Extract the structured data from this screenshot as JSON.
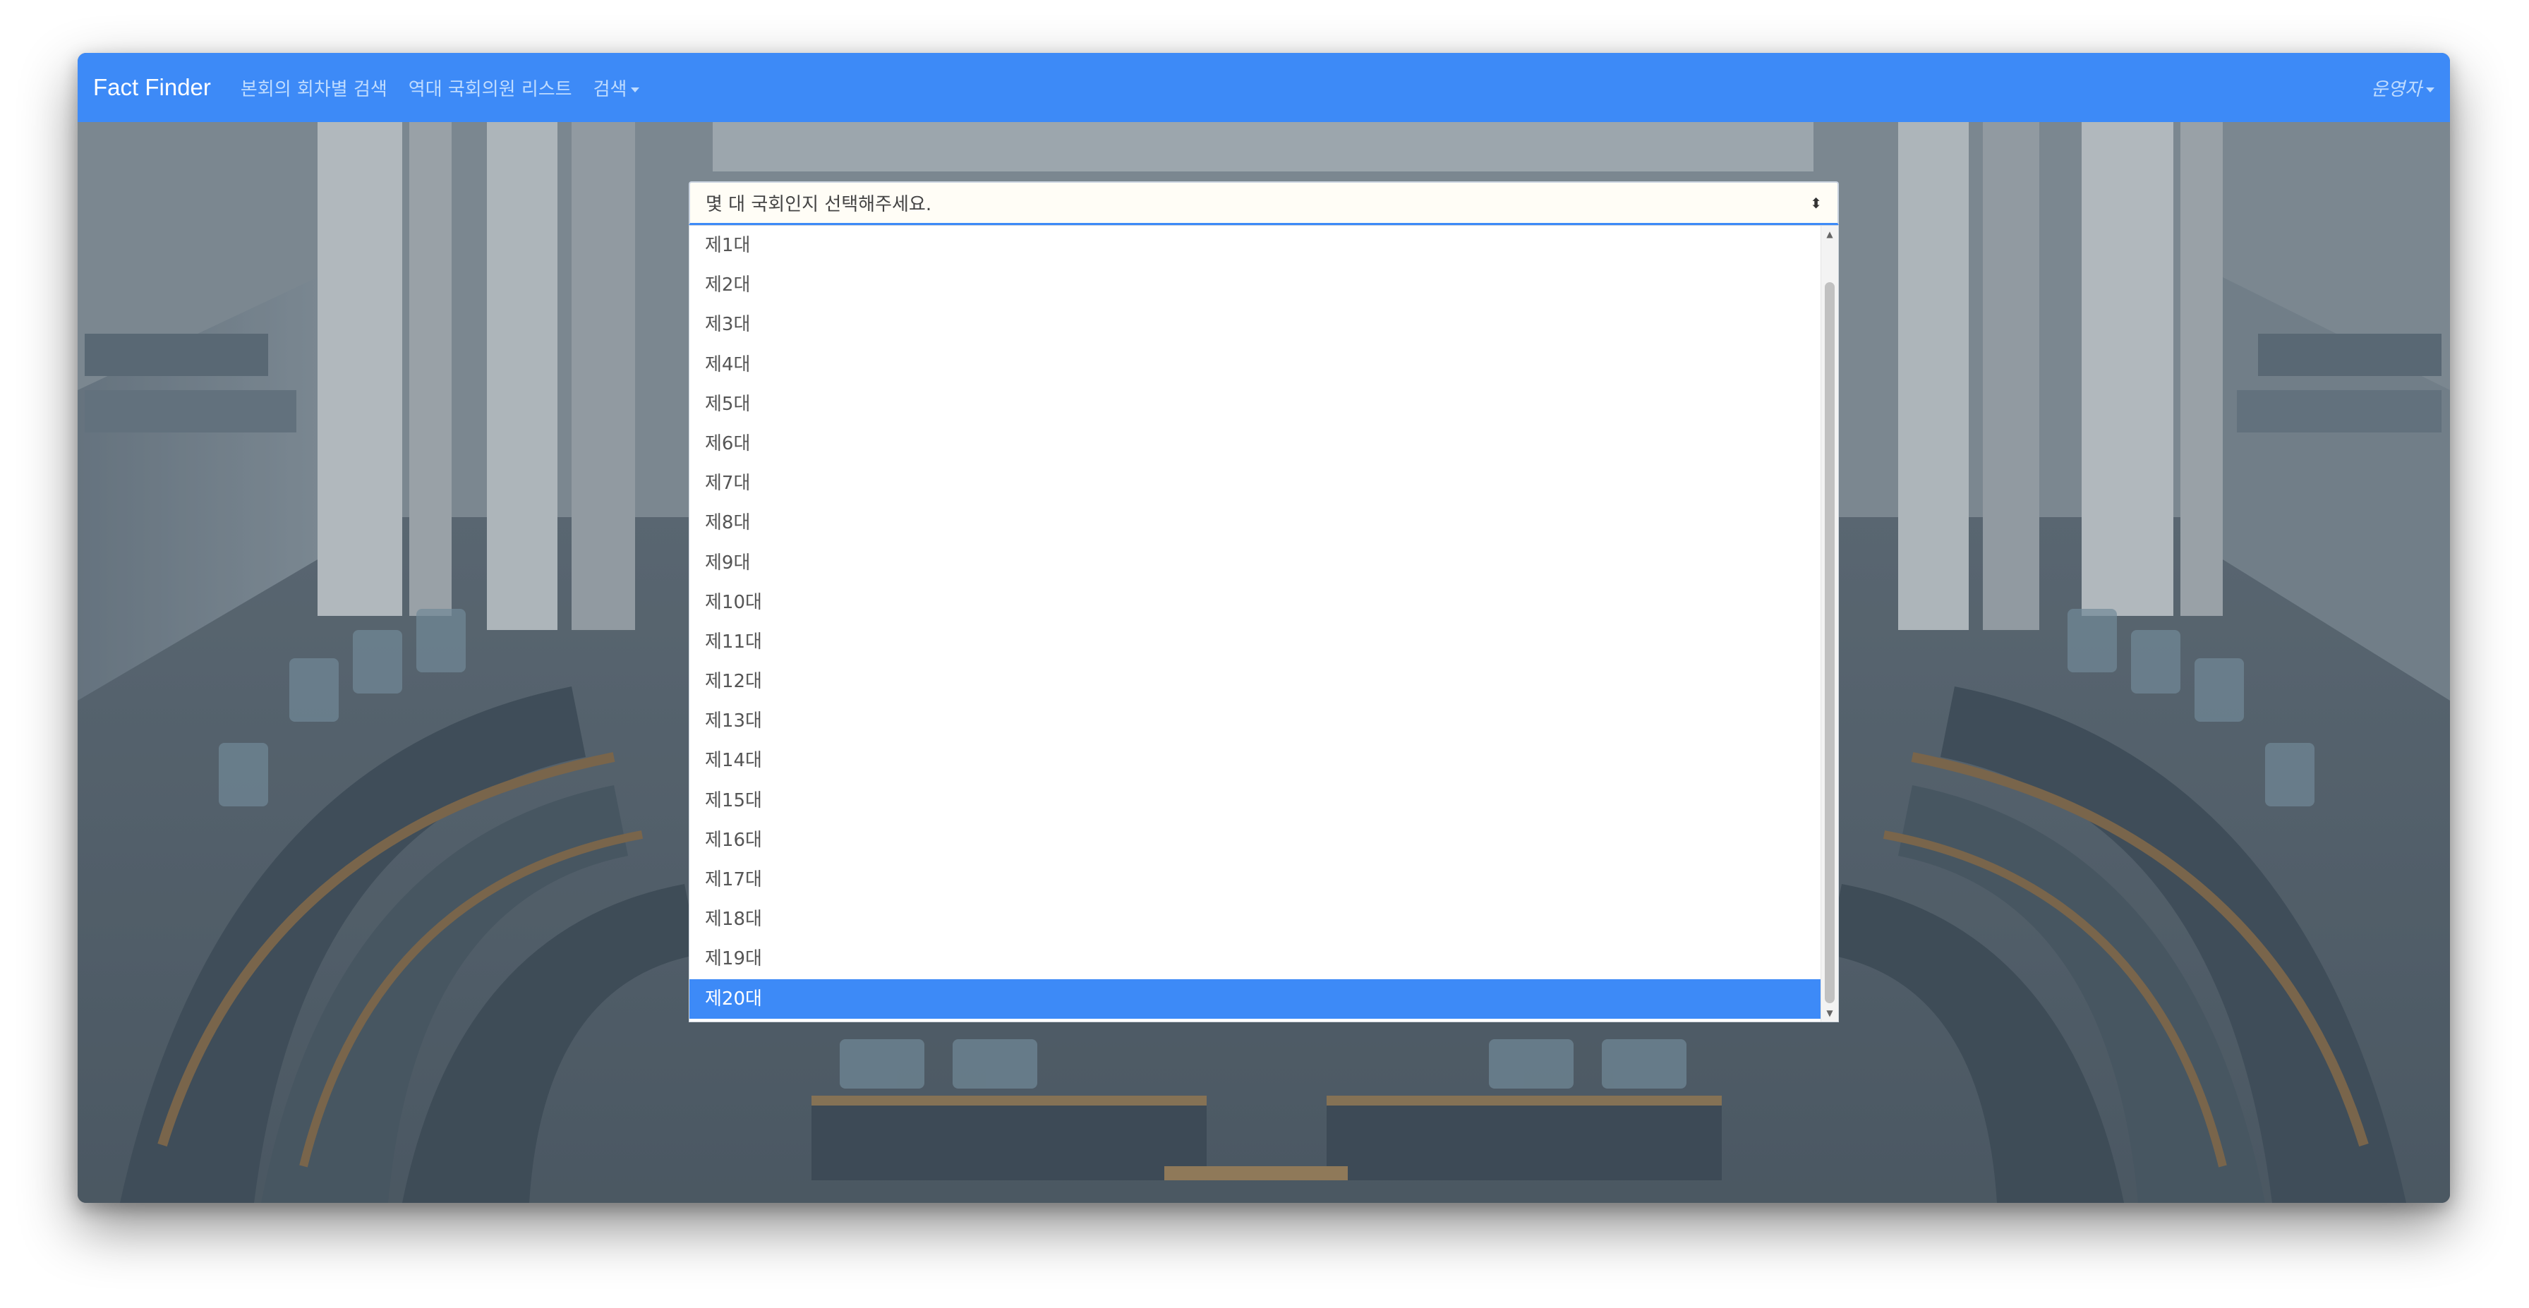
{
  "navbar": {
    "brand": "Fact Finder",
    "links": [
      {
        "label": "본회의 회차별 검색"
      },
      {
        "label": "역대 국회의원 리스트"
      },
      {
        "label": "검색"
      }
    ],
    "user_menu": "운영자"
  },
  "select": {
    "placeholder": "몇 대 국회인지 선택해주세요.",
    "options": [
      "제1대",
      "제2대",
      "제3대",
      "제4대",
      "제5대",
      "제6대",
      "제7대",
      "제8대",
      "제9대",
      "제10대",
      "제11대",
      "제12대",
      "제13대",
      "제14대",
      "제15대",
      "제16대",
      "제17대",
      "제18대",
      "제19대",
      "제20대"
    ],
    "highlighted_option": "제20대"
  },
  "colors": {
    "navbar": "#3d8af7",
    "highlight": "#3d8af7"
  }
}
